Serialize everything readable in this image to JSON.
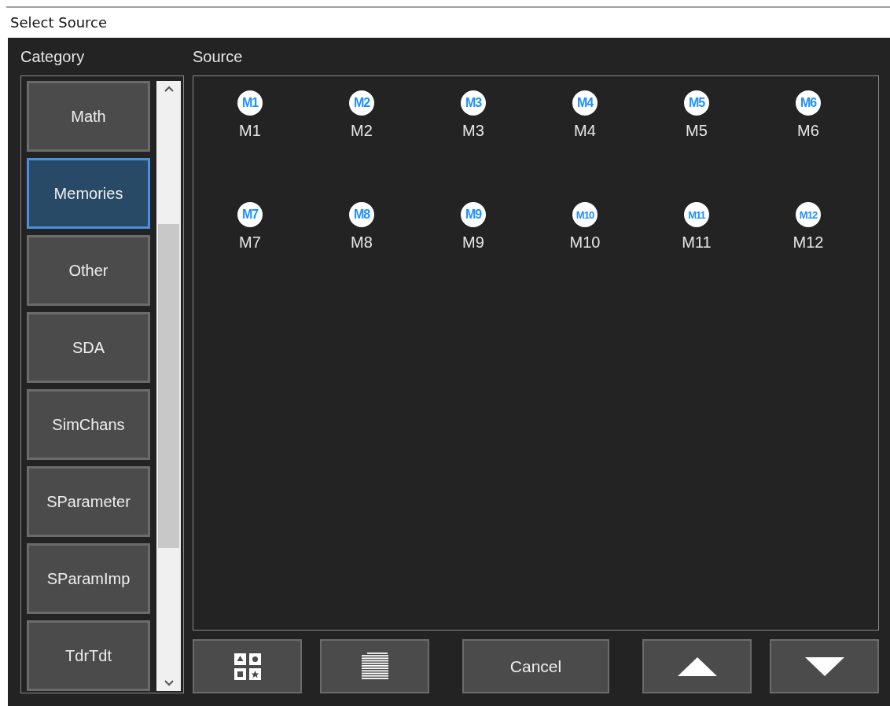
{
  "window": {
    "title": "Select Source"
  },
  "category": {
    "heading": "Category",
    "items": [
      {
        "label": "Math",
        "selected": false
      },
      {
        "label": "Memories",
        "selected": true
      },
      {
        "label": "Other",
        "selected": false
      },
      {
        "label": "SDA",
        "selected": false
      },
      {
        "label": "SimChans",
        "selected": false
      },
      {
        "label": "SParameter",
        "selected": false
      },
      {
        "label": "SParamImp",
        "selected": false
      },
      {
        "label": "TdrTdt",
        "selected": false
      }
    ]
  },
  "source": {
    "heading": "Source",
    "items": [
      {
        "badge": "M1",
        "label": "M1"
      },
      {
        "badge": "M2",
        "label": "M2"
      },
      {
        "badge": "M3",
        "label": "M3"
      },
      {
        "badge": "M4",
        "label": "M4"
      },
      {
        "badge": "M5",
        "label": "M5"
      },
      {
        "badge": "M6",
        "label": "M6"
      },
      {
        "badge": "M7",
        "label": "M7"
      },
      {
        "badge": "M8",
        "label": "M8"
      },
      {
        "badge": "M9",
        "label": "M9"
      },
      {
        "badge": "M10",
        "label": "M10"
      },
      {
        "badge": "M11",
        "label": "M11"
      },
      {
        "badge": "M12",
        "label": "M12"
      }
    ]
  },
  "buttons": [
    {
      "kind": "icons"
    },
    {
      "kind": "list"
    },
    {
      "kind": "text",
      "label": "Cancel"
    },
    {
      "kind": "up"
    },
    {
      "kind": "down"
    }
  ]
}
